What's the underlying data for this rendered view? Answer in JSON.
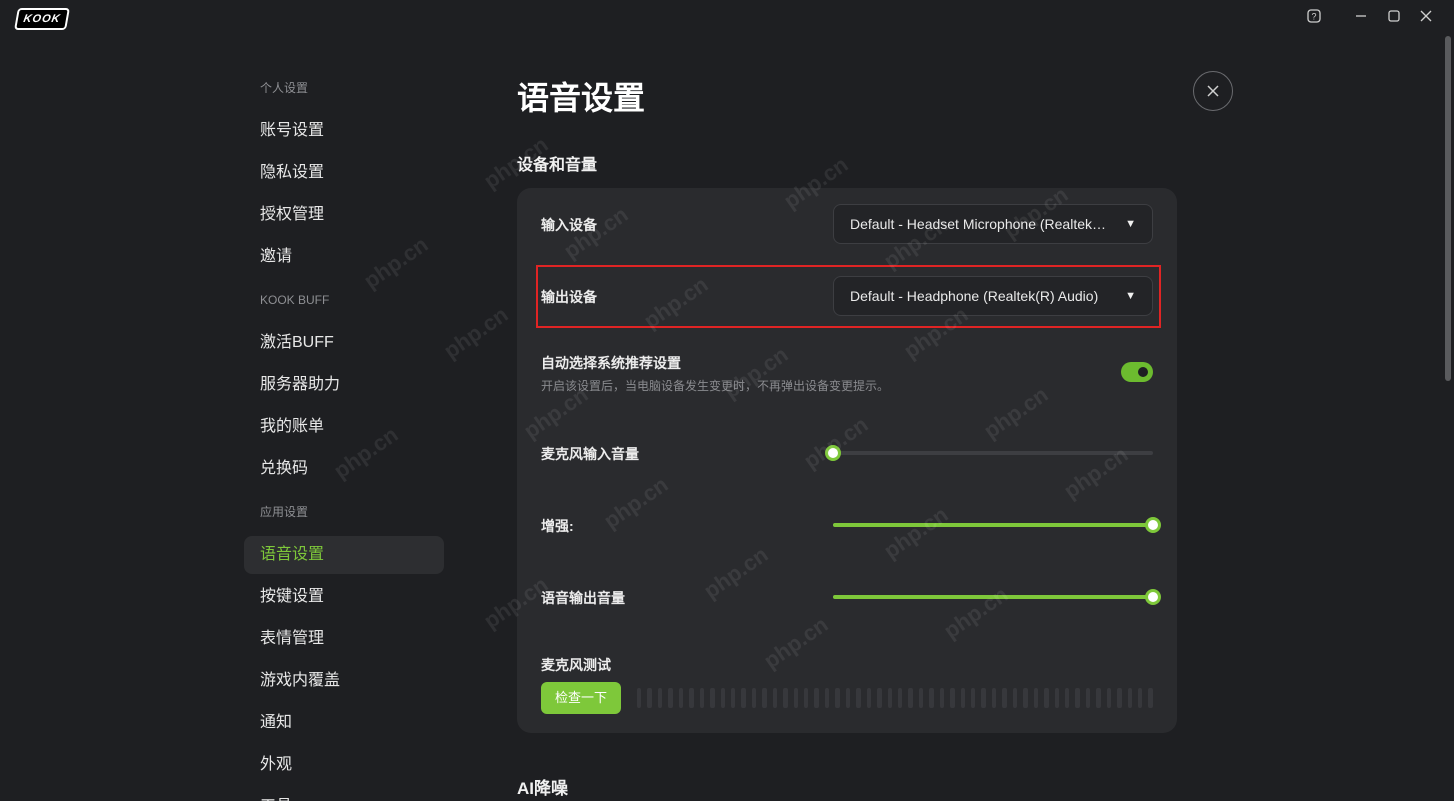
{
  "app": {
    "logo_text": "KOOK"
  },
  "window": {
    "help_icon": "help-icon",
    "minimize_icon": "minimize-icon",
    "maximize_icon": "maximize-icon",
    "close_icon": "close-icon"
  },
  "sidebar": {
    "groups": [
      {
        "title": "个人设置",
        "items": [
          "账号设置",
          "隐私设置",
          "授权管理",
          "邀请"
        ]
      },
      {
        "title": "KOOK BUFF",
        "items": [
          "激活BUFF",
          "服务器助力",
          "我的账单",
          "兑换码"
        ]
      },
      {
        "title": "应用设置",
        "items": [
          "语音设置",
          "按键设置",
          "表情管理",
          "游戏内覆盖",
          "通知",
          "外观",
          "工具"
        ]
      }
    ],
    "active_item": "语音设置"
  },
  "page": {
    "title": "语音设置",
    "section_devices": "设备和音量",
    "section_ai": "AI降噪"
  },
  "devices": {
    "input_label": "输入设备",
    "input_value": "Default - Headset Microphone (Realtek(R) Audio)",
    "output_label": "输出设备",
    "output_value": "Default - Headphone (Realtek(R) Audio)",
    "auto_label": "自动选择系统推荐设置",
    "auto_desc": "开启该设置后，当电脑设备发生变更时，不再弹出设备变更提示。",
    "auto_enabled": true,
    "mic_volume_label": "麦克风输入音量",
    "mic_volume": 0,
    "boost_label": "增强:",
    "boost": 100,
    "output_volume_label": "语音输出音量",
    "output_volume": 100,
    "mic_test_label": "麦克风测试",
    "mic_test_button": "检查一下"
  },
  "colors": {
    "accent": "#7ec83a",
    "highlight_border": "#e02424",
    "background": "#1e1f22",
    "card": "#2a2b2e"
  },
  "watermark": "php.cn"
}
